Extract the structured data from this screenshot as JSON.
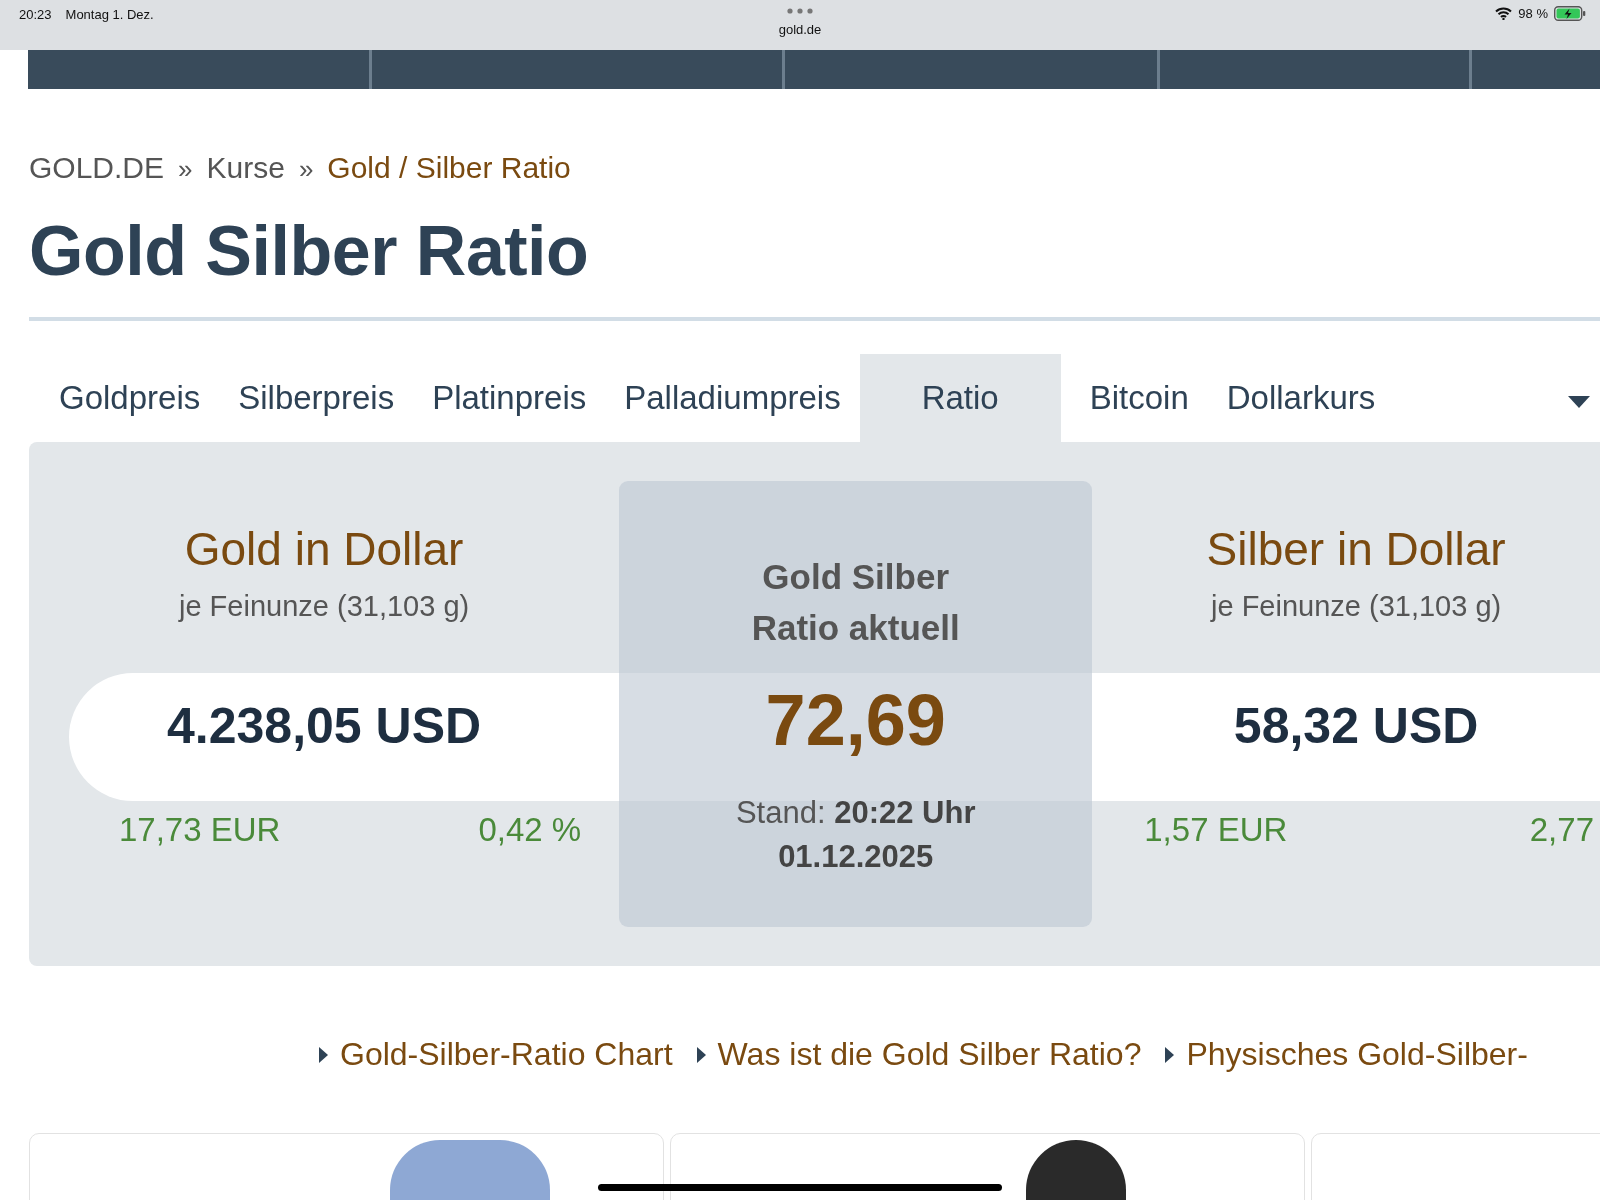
{
  "status_bar": {
    "time": "20:23",
    "date": "Montag 1. Dez.",
    "url": "gold.de",
    "battery": "98 %"
  },
  "breadcrumb": [
    {
      "label": "GOLD.DE",
      "current": false
    },
    {
      "label": "Kurse",
      "current": false
    },
    {
      "label": "Gold / Silber Ratio",
      "current": true
    }
  ],
  "breadcrumb_separator": "»",
  "title": "Gold Silber Ratio",
  "tabs": [
    {
      "label": "Goldpreis",
      "selected": false
    },
    {
      "label": "Silberpreis",
      "selected": false
    },
    {
      "label": "Platinpreis",
      "selected": false
    },
    {
      "label": "Palladiumpreis",
      "selected": false
    },
    {
      "label": "Ratio",
      "selected": true
    },
    {
      "label": "Bitcoin",
      "selected": false
    },
    {
      "label": "Dollarkurs",
      "selected": false
    }
  ],
  "gold": {
    "title": "Gold in Dollar",
    "subtitle": "je Feinunze (31,103 g)",
    "price": "4.238,05 USD",
    "eur": "17,73 EUR",
    "change": "0,42 %"
  },
  "ratio": {
    "heading": "Gold Silber Ratio aktuell",
    "value": "72,69",
    "stand": "Stand: **20:22 Uhr**",
    "date": "01.12.2025"
  },
  "silver": {
    "title": "Silber in Dollar",
    "subtitle": "je Feinunze (31,103 g)",
    "price": "58,32 USD",
    "eur": "1,57 EUR",
    "change": "2,77"
  },
  "links": [
    "Gold-Silber-Ratio Chart",
    "Was ist die Gold Silber Ratio?",
    "Physisches Gold-Silber-"
  ]
}
